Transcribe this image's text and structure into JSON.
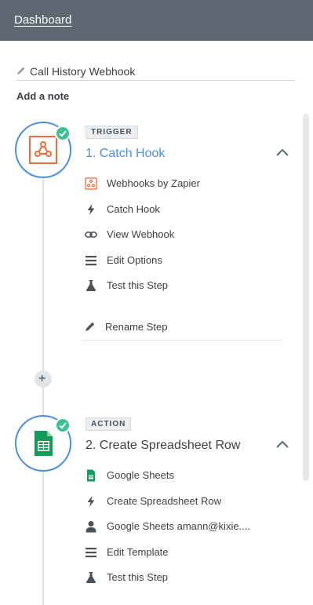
{
  "header": {
    "dashboard_link": "Dashboard"
  },
  "zap": {
    "title": "Call History Webhook",
    "add_note": "Add a note"
  },
  "steps": [
    {
      "badge": "TRIGGER",
      "title": "1. Catch Hook",
      "items": [
        {
          "label": "Webhooks by Zapier",
          "icon": "webhook-icon"
        },
        {
          "label": "Catch Hook",
          "icon": "bolt-icon"
        },
        {
          "label": "View Webhook",
          "icon": "link-icon"
        },
        {
          "label": "Edit Options",
          "icon": "list-icon"
        },
        {
          "label": "Test this Step",
          "icon": "flask-icon"
        }
      ],
      "rename": "Rename Step"
    },
    {
      "badge": "ACTION",
      "title": "2. Create Spreadsheet Row",
      "items": [
        {
          "label": "Google Sheets",
          "icon": "sheets-icon"
        },
        {
          "label": "Create Spreadsheet Row",
          "icon": "bolt-icon"
        },
        {
          "label": "Google Sheets amann@kixie....",
          "icon": "user-icon"
        },
        {
          "label": "Edit Template",
          "icon": "list-icon"
        },
        {
          "label": "Test this Step",
          "icon": "flask-icon"
        }
      ]
    }
  ],
  "colors": {
    "header_bg": "#5e6872",
    "accent_blue": "#4a90e2",
    "success_green": "#3cc194",
    "webhook_orange": "#f26b3a",
    "sheets_green": "#0f9d58"
  }
}
